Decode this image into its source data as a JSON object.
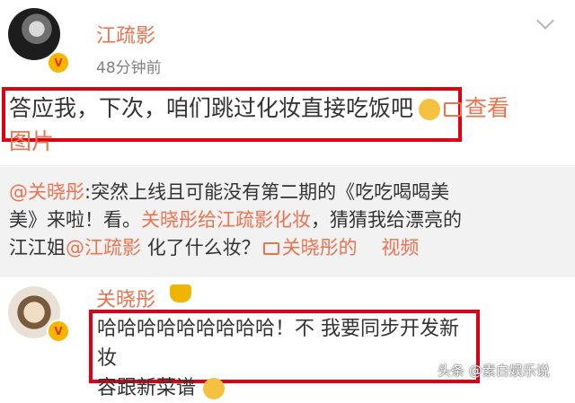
{
  "post": {
    "author": "江疏影",
    "timestamp": "48分钟前",
    "text_line1": "答应我，下次，咱们跳过化妆直接吃饭吧",
    "link_label": "查看",
    "link_label2": "图片",
    "emoji": "smiling-face"
  },
  "repost": {
    "line1_mention": "@关晓彤",
    "line1_text": ":突然上线且可能没有第二期的《吃吃喝喝美",
    "line2_text": "美》来啦！看。",
    "line2_link": "关晓彤给江疏影化妆",
    "line2_text2": "，猜猜我给漂亮的",
    "line3_text": "江江姐",
    "line3_mention": "@江疏影",
    "line3_text2": "化了什么妆？",
    "line3_video_label": "关晓彤的",
    "line3_video_suffix": "视频"
  },
  "comment": {
    "author": "关晓彤",
    "text_line1": "哈哈哈哈哈哈哈哈哈！不 我要同步开发新妆",
    "text_line2": "容跟新菜谱",
    "emoji": "relieved-face"
  },
  "watermark": "头条 @素白娱乐说",
  "colors": {
    "accent": "#eb7350",
    "highlight_box": "#e00015",
    "repost_bg": "#f2f2f2",
    "text": "#333333"
  }
}
